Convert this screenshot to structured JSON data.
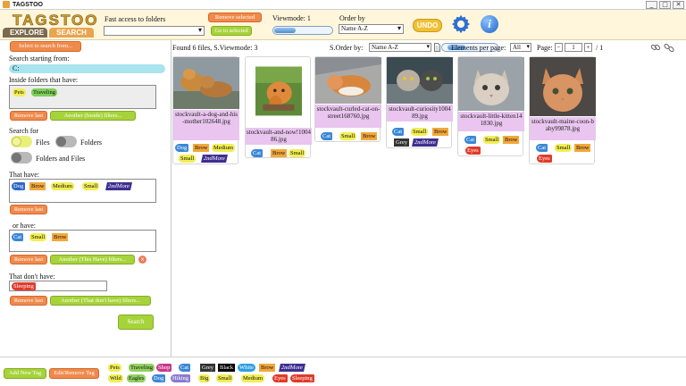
{
  "app": {
    "title": "TAGSTOO",
    "logo": "TAGSTOO"
  },
  "window": {
    "minimize": "_",
    "maximize": "□",
    "close": "✕"
  },
  "header": {
    "tabs": [
      {
        "label": "EXPLORE"
      },
      {
        "label": "SEARCH"
      }
    ],
    "fast_access_label": "Fast access to folders",
    "remove_selected": "Remove selected",
    "go_selected": "Go to selected",
    "viewmode_label": "Viewmode: 1",
    "order_by_label": "Order by",
    "order_by_value": "Name A-Z",
    "undo": "UNDO",
    "info_glyph": "i"
  },
  "left": {
    "select_folder_btn": "Select to search from...",
    "search_from_label": "Search starting from:",
    "search_from_value": "C:",
    "inside_label": "Inside folders that have:",
    "inside_tags": [
      "Pets",
      "Traveling"
    ],
    "remove_last": "Remove last",
    "another_inside": "Another (Inside) filters...",
    "search_for_label": "Search for",
    "files_label": "Files",
    "folders_label": "Folders",
    "folders_files_label": "Folders and Files",
    "that_have_label": "That have:",
    "that_have_tags": [
      "Dog",
      "Brow",
      "Medium",
      "Small",
      "2ndMore"
    ],
    "or_have_label": "or have:",
    "or_have_tags": [
      "Cat",
      "Small",
      "Brow"
    ],
    "another_this": "Another (This Have) filters...",
    "badge_x": "x",
    "dont_have_label": "That don't have:",
    "dont_have_tags": [
      "Sleeping"
    ],
    "another_dont": "Another (That don't have) filters...",
    "search_btn": "Search"
  },
  "results": {
    "found_text": "Found 6 files, S.Viewmode: 3",
    "order_label": "S.Order by:",
    "order_value": "Name A-Z",
    "per_page_label": "Elements per page:",
    "per_page_value": "All",
    "page_label": "Page:",
    "page_minus": "−",
    "page_value": "1",
    "page_plus": "+",
    "page_total": "/ 1",
    "cards": [
      {
        "caption": "stockvault-a-dog-and-his-mother102648.jpg",
        "tags": [
          "Dog",
          "Brow",
          "Medium",
          "Small",
          "2ndMore"
        ]
      },
      {
        "caption": "stockvault-and-now!100486.jpg",
        "tags": [
          "Cat",
          "Brow",
          "Small"
        ]
      },
      {
        "caption": "stockvault-curled-cat-on-street168760.jpg",
        "tags": [
          "Cat",
          "Small",
          "Brow"
        ]
      },
      {
        "caption": "stockvault-curiosity100489.jpg",
        "tags": [
          "Cat",
          "Small",
          "Brow",
          "Grey",
          "2ndMore"
        ]
      },
      {
        "caption": "stockvault-little-kitten141830.jpg",
        "tags": [
          "Cat",
          "Small",
          "Brow",
          "Eyes"
        ]
      },
      {
        "caption": "stockvault-maine-coon-baby99878.jpg",
        "tags": [
          "Cat",
          "Small",
          "Brow",
          "Eyes"
        ]
      }
    ]
  },
  "bottom": {
    "add_new_tag": "Add New Tag",
    "edit_remove_tag": "Edit/Remove Tag",
    "palette_row1": [
      "Pets",
      "Traveling",
      "Shop",
      "Cat",
      "Grey",
      "Black",
      "White",
      "Brow",
      "2ndMore"
    ],
    "palette_row2": [
      "Wild",
      "Eagles",
      "Dog",
      "Hiking",
      "Big",
      "Small",
      "Medium",
      "Eyes",
      "Sleeping"
    ]
  },
  "colors": {
    "accent_orange": "#f08a4b",
    "accent_green": "#a6d33a",
    "caption_bg": "#e9c5ef",
    "header_bg": "#fff6dc"
  }
}
